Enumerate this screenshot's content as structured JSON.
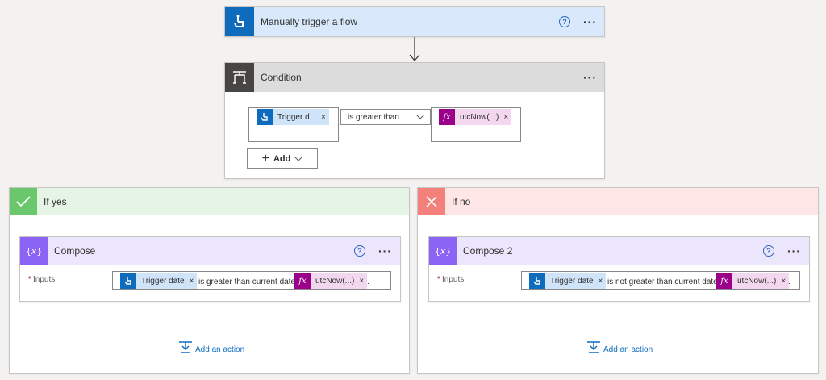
{
  "trigger": {
    "title": "Manually trigger a flow",
    "help": "?",
    "more": "···"
  },
  "condition": {
    "title": "Condition",
    "more": "···",
    "left_token": "Trigger d...",
    "operator": "is greater than",
    "right_token": "utcNow(...)",
    "add_label": "Add",
    "remove": "×"
  },
  "yes_branch": {
    "title": "If yes",
    "compose": {
      "title": "Compose",
      "help": "?",
      "more": "···",
      "required_mark": "*",
      "inputs_label": "Inputs",
      "token1": "Trigger date",
      "text": "is greater than current date",
      "token2": "utcNow(...)",
      "trailing": "."
    },
    "add_action": "Add an action"
  },
  "no_branch": {
    "title": "If no",
    "compose": {
      "title": "Compose 2",
      "help": "?",
      "more": "···",
      "required_mark": "*",
      "inputs_label": "Inputs",
      "token1": "Trigger date",
      "text": "is not greater than current date",
      "token2": "utcNow(...)",
      "trailing": "."
    },
    "add_action": "Add an action"
  },
  "colors": {
    "trigger_blue": "#0f6cbd",
    "trigger_header_bg": "#d9e8fb",
    "condition_gray": "#484644",
    "condition_header_bg": "#dcdcdc",
    "yes_green": "#6bc76b",
    "yes_header_bg": "#e6f4e6",
    "no_red": "#f3807a",
    "no_header_bg": "#fde6e5",
    "compose_purple": "#8b63f5",
    "compose_header_bg": "#ebe6fb",
    "fx_magenta": "#9a0089",
    "token_blue_bg": "#cfe3f9",
    "token_pink_bg": "#f2d7ef"
  }
}
